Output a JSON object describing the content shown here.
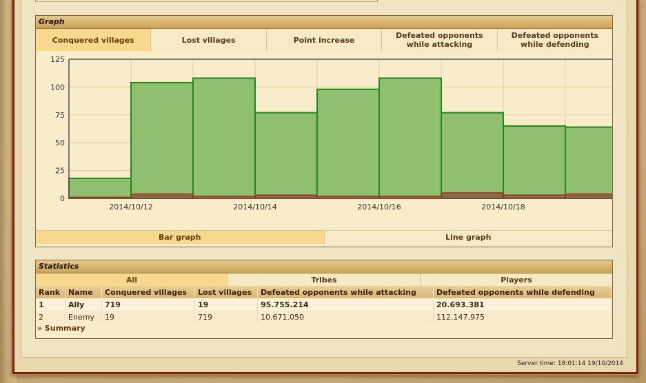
{
  "graph_box": {
    "title": "Graph",
    "tabs": [
      {
        "label": "Conquered villages",
        "active": true
      },
      {
        "label": "Lost villages",
        "active": false
      },
      {
        "label": "Point increase",
        "active": false
      },
      {
        "label": "Defeated opponents while attacking",
        "active": false
      },
      {
        "label": "Defeated opponents while defending",
        "active": false
      }
    ],
    "type_tabs": [
      {
        "label": "Bar graph",
        "active": true
      },
      {
        "label": "Line graph",
        "active": false
      }
    ]
  },
  "chart_data": {
    "type": "bar",
    "categories": [
      "2014/10/11",
      "2014/10/12",
      "2014/10/13",
      "2014/10/14",
      "2014/10/15",
      "2014/10/16",
      "2014/10/17",
      "2014/10/18",
      "2014/10/19"
    ],
    "x_tick_labels": [
      "2014/10/12",
      "2014/10/14",
      "2014/10/16",
      "2014/10/18"
    ],
    "series": [
      {
        "values": [
          18,
          104,
          108,
          77,
          98,
          108,
          77,
          65,
          64
        ],
        "color": "#8fbf6f"
      },
      {
        "values": [
          1,
          4,
          2,
          3,
          2,
          2,
          5,
          3,
          4
        ],
        "color": "#8a6a4a"
      }
    ],
    "ylim": [
      0,
      125
    ],
    "yticks": [
      0,
      25,
      50,
      75,
      100,
      125
    ],
    "grid": true
  },
  "stats_box": {
    "title": "Statistics",
    "tabs": [
      {
        "label": "All",
        "active": true
      },
      {
        "label": "Tribes",
        "active": false
      },
      {
        "label": "Players",
        "active": false
      }
    ],
    "columns": [
      "Rank",
      "Name",
      "Conquered villages",
      "Lost villages",
      "Defeated opponents while attacking",
      "Defeated opponents while defending"
    ],
    "rows": [
      [
        "1",
        "Ally",
        "719",
        "19",
        "95.755.214",
        "20.693.381"
      ],
      [
        "2",
        "Enemy",
        "19",
        "719",
        "10.671.050",
        "112.147.975"
      ]
    ],
    "summary_link": "» Summary"
  },
  "server_time": "Server time: 18:01:14 19/10/2014"
}
